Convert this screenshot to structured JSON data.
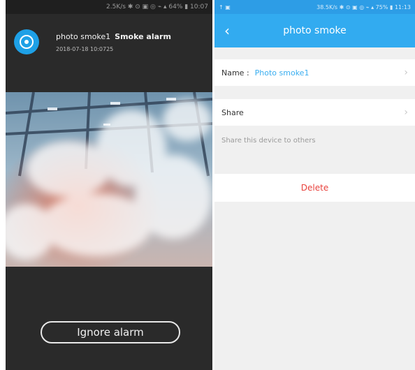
{
  "left": {
    "status_text": "2.5K/s ✱ ⊙ ▣ ◎ ⌁ ▴ 64% ▮ 10:07",
    "alarm": {
      "device_name": "photo smoke1",
      "alarm_type": "Smoke alarm",
      "timestamp": "2018-07-18 10:0725"
    },
    "ignore_button_label": "Ignore alarm"
  },
  "right": {
    "status_left": "↑ ▣",
    "status_right": "38.5K/s ✱ ⊙ ▣ ◎ ⌁ ▴ 75% ▮ 11:13",
    "back_icon": "‹",
    "title": "photo smoke",
    "name_label": "Name :",
    "name_value": "Photo smoke1",
    "share_label": "Share",
    "share_hint": "Share this device to others",
    "delete_label": "Delete",
    "chevron": "›"
  },
  "colors": {
    "accent": "#32abf0",
    "delete": "#e8413c",
    "dark_bg": "#2a2a2a"
  }
}
